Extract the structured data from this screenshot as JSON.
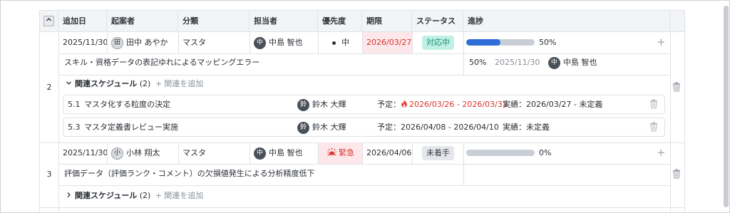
{
  "header": {
    "columns": [
      "追加日",
      "起案者",
      "分類",
      "担当者",
      "優先度",
      "期限",
      "ステータス",
      "進捗"
    ],
    "collapse_icon": "chevron-up-icon"
  },
  "rows": [
    {
      "number": "2",
      "added_date": "2025/11/30",
      "proposer": {
        "initial": "田",
        "name": "田中 あやか"
      },
      "category": "マスタ",
      "assignee": {
        "initial": "中",
        "name": "中島 智也"
      },
      "priority": "中",
      "deadline": "2026/03/27",
      "status": "対応中",
      "progress_label": "50%",
      "progress_value": 0.5,
      "title": "スキル・資格データの表記ゆれによるマッピングエラー",
      "latest_update": {
        "progress": "50%",
        "date": "2025/11/30",
        "initial": "中",
        "name": "中島 智也"
      },
      "related_label": "関連スケジュール",
      "related_count": "(2)",
      "add_related": "関連を追加",
      "schedules": [
        {
          "code": "5.1",
          "title": "マスタ化する粒度の決定",
          "initial": "鈴",
          "person": "鈴木 大輝",
          "planned_label": "予定：",
          "planned": "2026/03/26 - 2026/03/31",
          "actual": "実績：2026/03/27 - 未定義"
        },
        {
          "code": "5.3",
          "title": "マスタ定義書レビュー実施",
          "initial": "鈴",
          "person": "鈴木 大輝",
          "planned_label": "予定：",
          "planned": "2026/04/08 - 2026/04/10",
          "actual": "実績：未定義"
        }
      ]
    },
    {
      "number": "3",
      "added_date": "2025/11/30",
      "proposer": {
        "initial": "小",
        "name": "小林 翔太"
      },
      "category": "マスタ",
      "assignee": {
        "initial": "中",
        "name": "中島 智也"
      },
      "priority": "緊急",
      "deadline": "2026/04/06",
      "status": "未着手",
      "progress_label": "0%",
      "progress_value": 0,
      "title": "評価データ（評価ランク・コメント）の欠損値発生による分析精度低下",
      "related_label": "関連スケジュール",
      "related_count": "(2)",
      "add_related": "関連を追加"
    }
  ],
  "colors": {
    "status_in_progress_bg": "#bff0e6",
    "status_not_started_bg": "#e4e7eb",
    "deadline_overdue_bg": "#fde7ea",
    "priority_urgent_bg": "#fde7ea",
    "progress_fill": "#2f6fd6",
    "progress_track": "#c9ced6"
  }
}
